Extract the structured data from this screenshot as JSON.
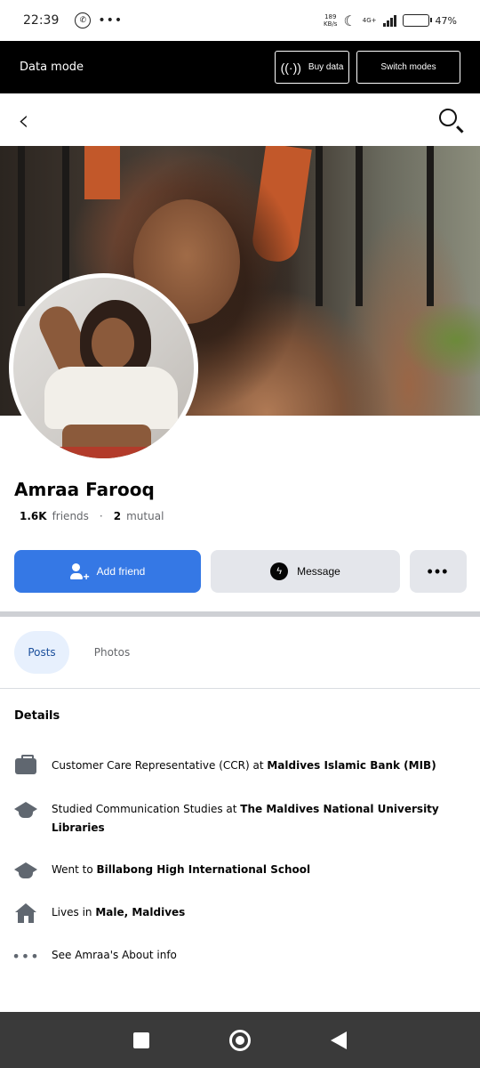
{
  "status_bar": {
    "time": "22:39",
    "net_speed_value": "189",
    "net_speed_unit": "KB/s",
    "network": "4G+",
    "battery": "47%",
    "battery_level": 0.47
  },
  "data_mode": {
    "label": "Data mode",
    "buy_label": "Buy data",
    "switch_label": "Switch modes"
  },
  "profile": {
    "name": "Amraa Farooq",
    "friends_count": "1.6K",
    "friends_label": "friends",
    "separator": "·",
    "mutual_count": "2",
    "mutual_label": "mutual"
  },
  "actions": {
    "add_friend": "Add friend",
    "message": "Message",
    "more": "•••"
  },
  "tabs": [
    {
      "label": "Posts"
    },
    {
      "label": "Photos"
    }
  ],
  "details": {
    "title": "Details",
    "items": [
      {
        "prefix": "Customer Care Representative (CCR) at ",
        "bold": "Maldives Islamic Bank (MIB)"
      },
      {
        "prefix": "Studied Communication Studies at ",
        "bold": "The Maldives National University Libraries"
      },
      {
        "prefix": "Went to ",
        "bold": "Billabong High International School"
      },
      {
        "prefix": "Lives in ",
        "bold": "Male, Maldives"
      },
      {
        "prefix": "See Amraa's About info",
        "bold": ""
      }
    ]
  },
  "colors": {
    "primary": "#3578e5",
    "secondary_button": "#e4e6eb",
    "active_tab_bg": "#e7f0fd",
    "active_tab_text": "#1b4f9c",
    "data_bar": "#000000",
    "system_nav": "#3a3a3a"
  },
  "icons": [
    "phone-icon",
    "overflow-dots-icon",
    "moon-icon",
    "signal-icon",
    "battery-icon",
    "antenna-icon",
    "back-arrow-icon",
    "search-icon",
    "add-friend-icon",
    "messenger-icon",
    "briefcase-icon",
    "graduation-cap-icon",
    "home-icon",
    "more-dots-icon",
    "recents-icon",
    "home-nav-icon",
    "back-nav-icon"
  ]
}
